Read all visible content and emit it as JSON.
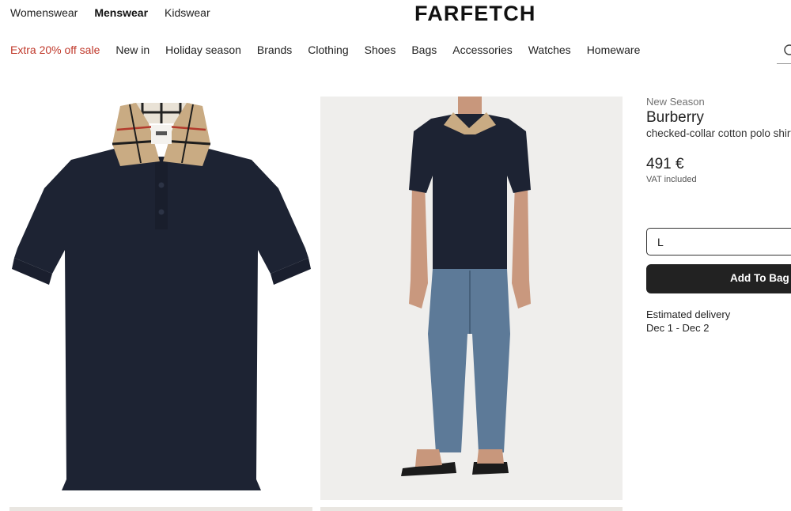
{
  "header": {
    "departments": [
      "Womenswear",
      "Menswear",
      "Kidswear"
    ],
    "active_department": "Menswear",
    "logo": "FARFETCH"
  },
  "nav": {
    "items": [
      "Extra 20% off sale",
      "New in",
      "Holiday season",
      "Brands",
      "Clothing",
      "Shoes",
      "Bags",
      "Accessories",
      "Watches",
      "Homeware"
    ],
    "sale_color": "#c0392b"
  },
  "product": {
    "label": "New Season",
    "brand": "Burberry",
    "name": "checked-collar cotton polo shirt",
    "price": "491 €",
    "vat": "VAT included",
    "size": "L",
    "add_to_bag": "Add To Bag",
    "delivery_label": "Estimated delivery",
    "delivery_dates": "Dec 1 - Dec 2"
  },
  "colors": {
    "shirt_navy": "#1c2232",
    "collar_check": "#c9ab83",
    "jeans": "#5d7a98",
    "button_dark": "#222222"
  }
}
